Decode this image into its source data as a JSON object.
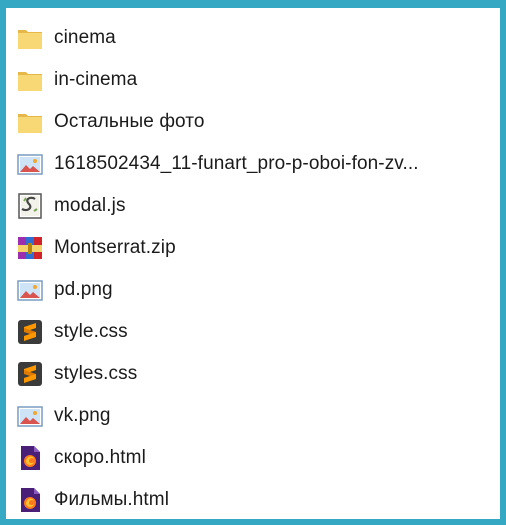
{
  "files": [
    {
      "name": "cinema",
      "type": "folder",
      "icon": "folder-icon"
    },
    {
      "name": "in-cinema",
      "type": "folder",
      "icon": "folder-icon"
    },
    {
      "name": "Остальные фото",
      "type": "folder",
      "icon": "folder-icon"
    },
    {
      "name": "1618502434_11-funart_pro-p-oboi-fon-zv...",
      "type": "image",
      "icon": "image-file-icon"
    },
    {
      "name": "modal.js",
      "type": "script",
      "icon": "script-file-icon"
    },
    {
      "name": "Montserrat.zip",
      "type": "archive",
      "icon": "archive-file-icon"
    },
    {
      "name": "pd.png",
      "type": "image",
      "icon": "image-file-icon"
    },
    {
      "name": "style.css",
      "type": "stylesheet",
      "icon": "sublime-file-icon"
    },
    {
      "name": "styles.css",
      "type": "stylesheet",
      "icon": "sublime-file-icon"
    },
    {
      "name": "vk.png",
      "type": "image",
      "icon": "image-file-icon"
    },
    {
      "name": "скоро.html",
      "type": "html",
      "icon": "html-file-icon"
    },
    {
      "name": "Фильмы.html",
      "type": "html",
      "icon": "html-file-icon"
    }
  ],
  "colors": {
    "background": "#35a9c4",
    "folder": "#f7d46d",
    "sublime": "#ff9800",
    "html_doc": "#5b2a86"
  }
}
